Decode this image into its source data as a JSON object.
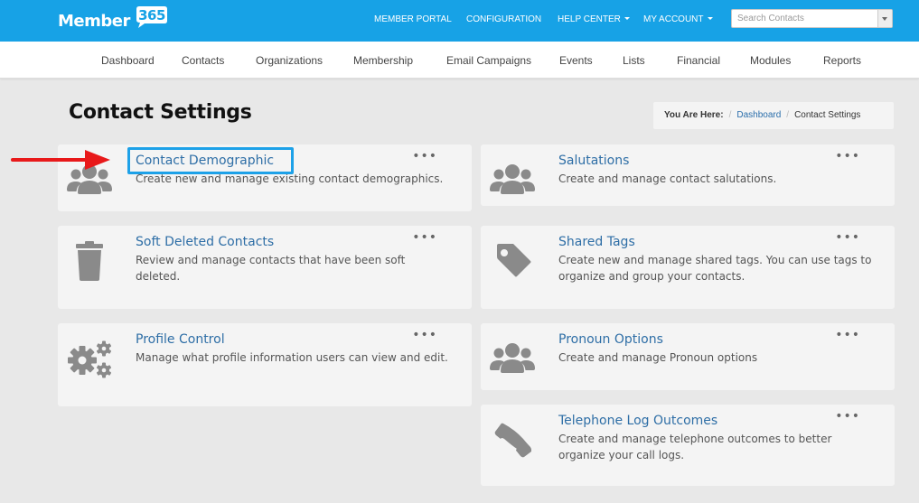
{
  "brand": {
    "logo_text": "Member",
    "logo_badge": "365",
    "accent_color": "#17a2e6"
  },
  "topnav": {
    "items": [
      {
        "label": "MEMBER PORTAL",
        "dropdown": false
      },
      {
        "label": "CONFIGURATION",
        "dropdown": false
      },
      {
        "label": "HELP CENTER",
        "dropdown": true
      },
      {
        "label": "MY ACCOUNT",
        "dropdown": true
      }
    ],
    "search_placeholder": "Search Contacts"
  },
  "subnav": {
    "items": [
      "Dashboard",
      "Contacts",
      "Organizations",
      "Membership",
      "Email Campaigns",
      "Events",
      "Lists",
      "Financial",
      "Modules",
      "Reports"
    ]
  },
  "page": {
    "title": "Contact Settings"
  },
  "breadcrumb": {
    "label": "You Are Here:",
    "link": "Dashboard",
    "current": "Contact Settings"
  },
  "cards": [
    {
      "title": "Contact Demographic",
      "description": "Create new and manage existing contact demographics.",
      "icon": "users-icon",
      "menu": "•••"
    },
    {
      "title": "Salutations",
      "description": "Create and manage contact salutations.",
      "icon": "users-icon",
      "menu": "•••"
    },
    {
      "title": "Soft Deleted Contacts",
      "description": "Review and manage contacts that have been soft deleted.",
      "icon": "trash-icon",
      "menu": "•••"
    },
    {
      "title": "Shared Tags",
      "description": "Create new and manage shared tags. You can use tags to organize and group your contacts.",
      "icon": "tag-icon",
      "menu": "•••"
    },
    {
      "title": "Profile Control",
      "description": "Manage what profile information users can view and edit.",
      "icon": "gears-icon",
      "menu": "•••"
    },
    {
      "title": "Pronoun Options",
      "description": "Create and manage Pronoun options",
      "icon": "users-icon",
      "menu": "•••"
    },
    {
      "title": "Telephone Log Outcomes",
      "description": "Create and manage telephone outcomes to better organize your call logs.",
      "icon": "phone-icon",
      "menu": "•••"
    }
  ]
}
